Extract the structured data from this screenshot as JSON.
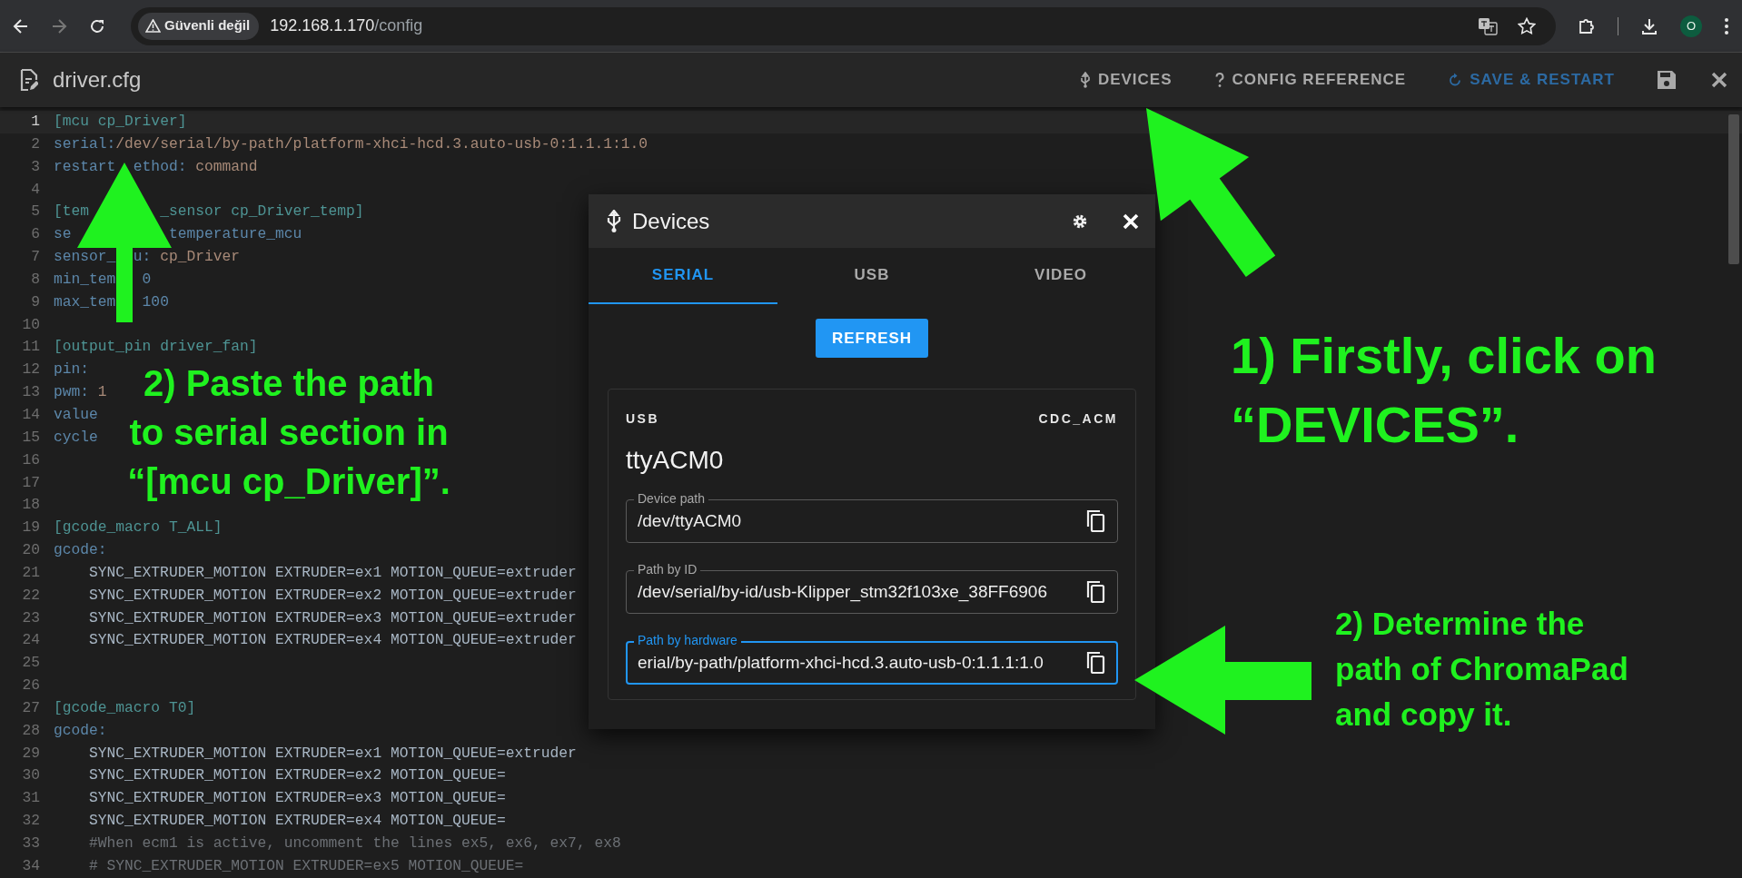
{
  "browser": {
    "security_label": "Güvenli değil",
    "url_host": "192.168.1.170",
    "url_path": "/config",
    "profile_initial": "O"
  },
  "toolbar": {
    "file_name": "driver.cfg",
    "actions": [
      {
        "label": "DEVICES",
        "kind": "devices"
      },
      {
        "label": "CONFIG REFERENCE",
        "kind": "reference"
      },
      {
        "label": "SAVE & RESTART",
        "kind": "save-restart"
      }
    ]
  },
  "editor": {
    "lines": [
      {
        "number": "1",
        "kind": "section",
        "text": "[mcu cp_Driver]",
        "selected": true
      },
      {
        "number": "2",
        "kind": "setting",
        "text": "serial:/dev/serial/by-path/platform-xhci-hcd.3.auto-usb-0:1.1.1:1.0",
        "selected": false
      },
      {
        "number": "3",
        "kind": "setting",
        "text": "restart  ethod: command",
        "selected": false
      },
      {
        "number": "4",
        "kind": "blank",
        "selected": false
      },
      {
        "number": "5",
        "kind": "section",
        "text": "[tem        _sensor cp_Driver_temp]",
        "selected": false
      },
      {
        "number": "6",
        "kind": "setting",
        "text": "se           temperature_mcu",
        "selected": false
      },
      {
        "number": "7",
        "kind": "setting",
        "text": "sensor_  u: cp_Driver",
        "selected": false
      },
      {
        "number": "8",
        "kind": "setting",
        "text": "min_tem   0",
        "selected": false
      },
      {
        "number": "9",
        "kind": "setting",
        "text": "max_tem   100",
        "selected": false
      },
      {
        "number": "10",
        "kind": "blank",
        "selected": false
      },
      {
        "number": "11",
        "kind": "section",
        "text": "[output_pin driver_fan]",
        "selected": false
      },
      {
        "number": "12",
        "kind": "setting",
        "text": "pin:",
        "selected": false
      },
      {
        "number": "13",
        "kind": "setting",
        "text": "pwm: 1",
        "selected": false
      },
      {
        "number": "14",
        "kind": "setting",
        "text": "value",
        "selected": false
      },
      {
        "number": "15",
        "kind": "setting",
        "text": "cycle",
        "selected": false
      },
      {
        "number": "16",
        "kind": "blank",
        "selected": false
      },
      {
        "number": "17",
        "kind": "blank",
        "selected": false
      },
      {
        "number": "18",
        "kind": "blank",
        "selected": false
      },
      {
        "number": "19",
        "kind": "section",
        "text": "[gcode_macro T_ALL]",
        "selected": false
      },
      {
        "number": "20",
        "kind": "setting",
        "text": "gcode:",
        "selected": false
      },
      {
        "number": "21",
        "kind": "code",
        "text": "SYNC_EXTRUDER_MOTION EXTRUDER=ex1 MOTION_QUEUE=extruder",
        "selected": false
      },
      {
        "number": "22",
        "kind": "code",
        "text": "SYNC_EXTRUDER_MOTION EXTRUDER=ex2 MOTION_QUEUE=extruder",
        "selected": false
      },
      {
        "number": "23",
        "kind": "code",
        "text": "SYNC_EXTRUDER_MOTION EXTRUDER=ex3 MOTION_QUEUE=extruder",
        "selected": false
      },
      {
        "number": "24",
        "kind": "code",
        "text": "SYNC_EXTRUDER_MOTION EXTRUDER=ex4 MOTION_QUEUE=extruder",
        "selected": false
      },
      {
        "number": "25",
        "kind": "blank",
        "selected": false
      },
      {
        "number": "26",
        "kind": "blank",
        "selected": false
      },
      {
        "number": "27",
        "kind": "section",
        "text": "[gcode_macro T0]",
        "selected": false
      },
      {
        "number": "28",
        "kind": "setting",
        "text": "gcode:",
        "selected": false
      },
      {
        "number": "29",
        "kind": "code",
        "text": "SYNC_EXTRUDER_MOTION EXTRUDER=ex1 MOTION_QUEUE=extruder",
        "selected": false
      },
      {
        "number": "30",
        "kind": "code",
        "text": "SYNC_EXTRUDER_MOTION EXTRUDER=ex2 MOTION_QUEUE=",
        "selected": false
      },
      {
        "number": "31",
        "kind": "code",
        "text": "SYNC_EXTRUDER_MOTION EXTRUDER=ex3 MOTION_QUEUE=",
        "selected": false
      },
      {
        "number": "32",
        "kind": "code",
        "text": "SYNC_EXTRUDER_MOTION EXTRUDER=ex4 MOTION_QUEUE=",
        "selected": false
      },
      {
        "number": "33",
        "kind": "comment",
        "text": "#When ecm1 is active, uncomment the lines ex5, ex6, ex7, ex8",
        "selected": false
      },
      {
        "number": "34",
        "kind": "comment",
        "text": "# SYNC_EXTRUDER_MOTION EXTRUDER=ex5 MOTION_QUEUE=",
        "selected": false
      }
    ]
  },
  "devices_dialog": {
    "title": "Devices",
    "tabs": [
      {
        "label": "SERIAL",
        "selected": true
      },
      {
        "label": "USB",
        "selected": false
      },
      {
        "label": "VIDEO",
        "selected": false
      }
    ],
    "refresh_button": "REFRESH",
    "device": {
      "bus": "USB",
      "driver": "CDC_ACM",
      "name": "ttyACM0",
      "fields": [
        {
          "label": "Device path",
          "value": "/dev/ttyACM0",
          "focused": false
        },
        {
          "label": "Path by ID",
          "value": "/dev/serial/by-id/usb-Klipper_stm32f103xe_38FF6906",
          "focused": false
        },
        {
          "label": "Path by hardware",
          "value": "erial/by-path/platform-xhci-hcd.3.auto-usb-0:1.1.1:1.0",
          "focused": true
        }
      ]
    }
  },
  "annotations": [
    {
      "kind": "paste",
      "lines": [
        "2) Paste the path",
        "to serial section in",
        "“[mcu cp_Driver]”."
      ]
    },
    {
      "kind": "click",
      "lines": [
        "1) Firstly, click on",
        "“DEVICES”."
      ]
    },
    {
      "kind": "copy",
      "lines": [
        "2) Determine the",
        "path of ChromaPad",
        "and copy it."
      ]
    }
  ]
}
